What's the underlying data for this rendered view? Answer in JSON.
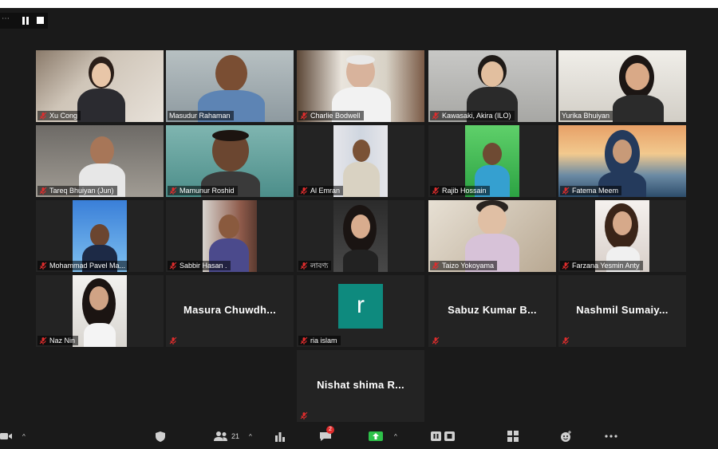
{
  "meeting": {
    "participants_count": "21",
    "chat_badge": "2"
  },
  "participants": [
    {
      "name": "Xu Cong"
    },
    {
      "name": "Masudur Rahaman"
    },
    {
      "name": "Charlie Bodwell"
    },
    {
      "name": "Kawasaki, Akira (ILO)"
    },
    {
      "name": "Yurika Bhuiyan"
    },
    {
      "name": "Tareq Bhuiyan (Jun)"
    },
    {
      "name": "Mamunur Roshid"
    },
    {
      "name": "Al Emran"
    },
    {
      "name": "Rajib Hossain"
    },
    {
      "name": "Fatema Meem"
    },
    {
      "name": "Mohammad Pavel Ma..."
    },
    {
      "name": "Sabbir Hasan ."
    },
    {
      "name": "লাবণ্য"
    },
    {
      "name": "Taizo Yokoyama"
    },
    {
      "name": "Farzana Yesmin Anty"
    },
    {
      "name": "Naz Nin"
    },
    {
      "name": "Masura  Chuwdh..."
    },
    {
      "name": "ria islam",
      "avatar_letter": "r"
    },
    {
      "name": "Sabuz Kumar B..."
    },
    {
      "name": "Nashmil Sumaiy..."
    },
    {
      "name": "Nishat  shima  R..."
    }
  ],
  "colors": {
    "background": "#1a1a1a",
    "tile": "#232323",
    "active_speaker_border": "#c6e04a",
    "avatar": "#0e8a7e",
    "mute_icon": "#e02d2d",
    "share_button": "#2ec24a"
  },
  "toolbar_icons": [
    "video-icon",
    "security-shield-icon",
    "participants-icon",
    "polls-icon",
    "chat-icon",
    "share-screen-icon",
    "record-icon",
    "breakout-rooms-icon",
    "reactions-icon",
    "more-icon"
  ]
}
